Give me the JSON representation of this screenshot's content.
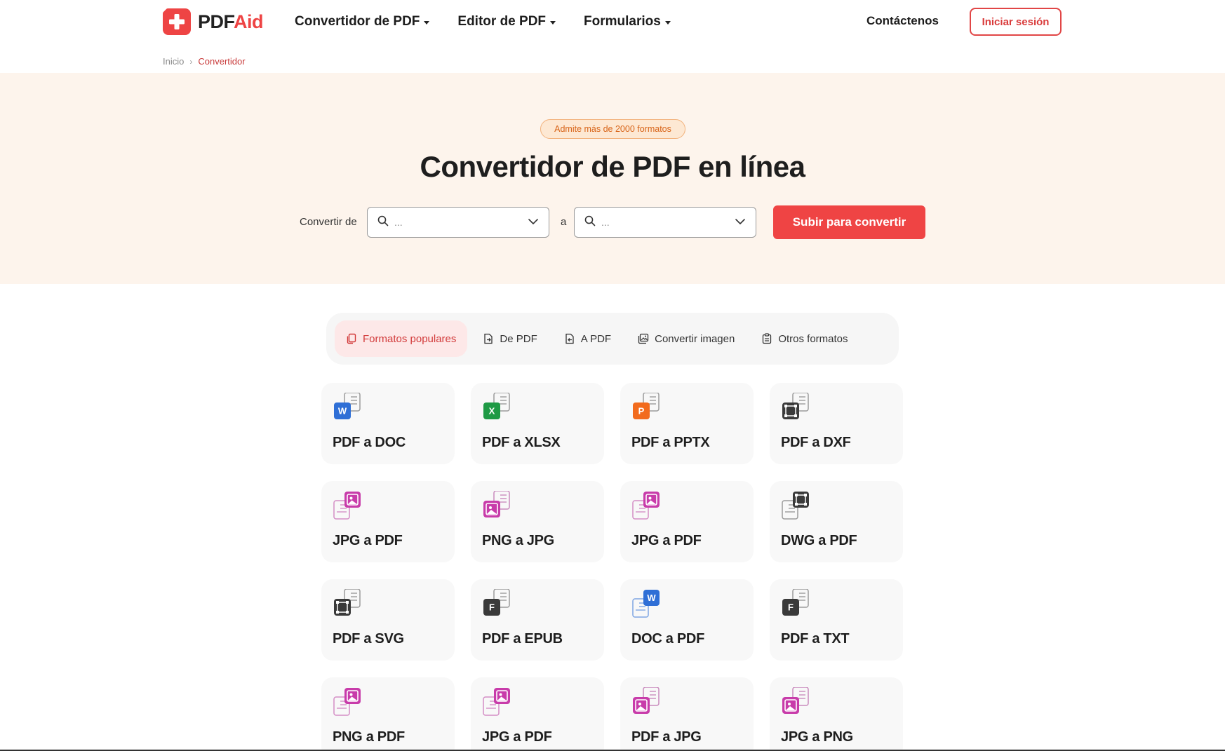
{
  "header": {
    "logo_pdf": "PDF",
    "logo_aid": "Aid",
    "nav": [
      {
        "label": "Convertidor de PDF"
      },
      {
        "label": "Editor de PDF"
      },
      {
        "label": "Formularios"
      }
    ],
    "contact": "Contáctenos",
    "login": "Iniciar sesión"
  },
  "breadcrumb": {
    "home": "Inicio",
    "current": "Convertidor"
  },
  "hero": {
    "badge": "Admite más de 2000 formatos",
    "title": "Convertidor de PDF en línea",
    "convert_from_label": "Convertir de",
    "to_label": "a",
    "from_placeholder": "...",
    "to_placeholder": "...",
    "upload_button": "Subir para convertir"
  },
  "tabs": [
    {
      "label": "Formatos populares",
      "icon": "copy-icon",
      "active": true
    },
    {
      "label": "De PDF",
      "icon": "file-export-icon",
      "active": false
    },
    {
      "label": "A PDF",
      "icon": "file-import-icon",
      "active": false
    },
    {
      "label": "Convertir imagen",
      "icon": "image-icon",
      "active": false
    },
    {
      "label": "Otros formatos",
      "icon": "clipboard-icon",
      "active": false
    }
  ],
  "tools": [
    {
      "label": "PDF a DOC",
      "icon": "word-icon",
      "badge": "W",
      "color": "#2f6fd6",
      "badge_position": "front"
    },
    {
      "label": "PDF a XLSX",
      "icon": "excel-icon",
      "badge": "X",
      "color": "#1f9a45",
      "badge_position": "front"
    },
    {
      "label": "PDF a PPTX",
      "icon": "powerpoint-icon",
      "badge": "P",
      "color": "#f26b1d",
      "badge_position": "front"
    },
    {
      "label": "PDF a DXF",
      "icon": "cad-icon",
      "badge": "cad",
      "color": "#3a3a3a",
      "badge_position": "front"
    },
    {
      "label": "JPG a PDF",
      "icon": "image-to-pdf-icon",
      "badge": "img",
      "color": "#c83caa",
      "badge_position": "back"
    },
    {
      "label": "PNG a JPG",
      "icon": "image-convert-icon",
      "badge": "img",
      "color": "#c83caa",
      "badge_position": "front"
    },
    {
      "label": "JPG a PDF",
      "icon": "image-to-pdf-icon",
      "badge": "img",
      "color": "#c83caa",
      "badge_position": "back"
    },
    {
      "label": "DWG a PDF",
      "icon": "cad-to-pdf-icon",
      "badge": "cad",
      "color": "#3a3a3a",
      "badge_position": "back"
    },
    {
      "label": "PDF a SVG",
      "icon": "vector-icon",
      "badge": "cad",
      "color": "#3a3a3a",
      "badge_position": "front"
    },
    {
      "label": "PDF a EPUB",
      "icon": "ebook-icon",
      "badge": "F",
      "color": "#3a3a3a",
      "badge_position": "front"
    },
    {
      "label": "DOC a PDF",
      "icon": "word-to-pdf-icon",
      "badge": "W",
      "color": "#2f6fd6",
      "badge_position": "back"
    },
    {
      "label": "PDF a TXT",
      "icon": "text-icon",
      "badge": "F",
      "color": "#3a3a3a",
      "badge_position": "front"
    },
    {
      "label": "PNG a PDF",
      "icon": "image-to-pdf-icon",
      "badge": "img",
      "color": "#c83caa",
      "badge_position": "back"
    },
    {
      "label": "JPG a PDF",
      "icon": "image-to-pdf-icon",
      "badge": "img",
      "color": "#c83caa",
      "badge_position": "back"
    },
    {
      "label": "PDF a JPG",
      "icon": "pdf-to-image-icon",
      "badge": "img",
      "color": "#c83caa",
      "badge_position": "front"
    },
    {
      "label": "JPG a PNG",
      "icon": "image-convert-icon",
      "badge": "img",
      "color": "#c83caa",
      "badge_position": "front"
    }
  ],
  "colors": {
    "accent": "#ef4444",
    "hero_bg": "#fdf4ec",
    "badge_bg": "#fde8d3",
    "badge_text": "#d86418"
  }
}
